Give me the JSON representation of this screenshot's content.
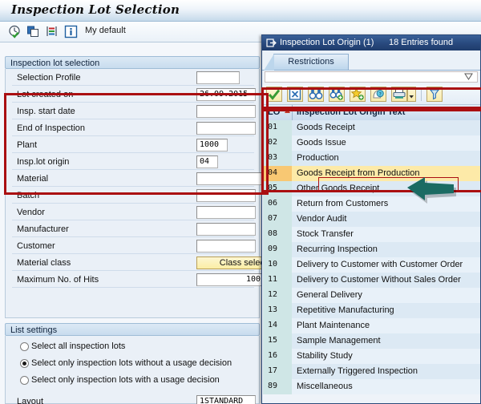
{
  "window": {
    "title": "Inspection Lot Selection",
    "toolbar": {
      "icons": [
        "execute-clock-icon",
        "copy-icon",
        "variant-icon",
        "info-icon"
      ],
      "my_default_label": "My default"
    }
  },
  "selection_section": {
    "header": "Inspection lot selection",
    "fields": [
      {
        "label": "Selection Profile",
        "value": "",
        "type": "input",
        "align": "left"
      },
      {
        "label": "Lot created on",
        "value": "26.09.2015",
        "type": "input",
        "align": "left"
      },
      {
        "label": "Insp. start date",
        "value": "",
        "type": "input",
        "align": "left"
      },
      {
        "label": "End of Inspection",
        "value": "",
        "type": "input",
        "align": "left"
      },
      {
        "label": "Plant",
        "value": "1000",
        "type": "input",
        "align": "left"
      },
      {
        "label": "Insp.lot origin",
        "value": "04",
        "type": "input",
        "align": "left"
      },
      {
        "label": "Material",
        "value": "",
        "type": "input",
        "align": "left"
      },
      {
        "label": "Batch",
        "value": "",
        "type": "input",
        "align": "left"
      },
      {
        "label": "Vendor",
        "value": "",
        "type": "input",
        "align": "left"
      },
      {
        "label": "Manufacturer",
        "value": "",
        "type": "input",
        "align": "left"
      },
      {
        "label": "Customer",
        "value": "",
        "type": "input",
        "align": "left"
      },
      {
        "label": "Material class",
        "value": "Class selec",
        "type": "button",
        "align": "right"
      },
      {
        "label": "Maximum No. of Hits",
        "value": "100",
        "type": "input",
        "align": "right"
      }
    ]
  },
  "list_settings": {
    "header": "List settings",
    "options": [
      {
        "label": "Select all inspection lots",
        "selected": false
      },
      {
        "label": "Select only inspection lots without a usage decision",
        "selected": true
      },
      {
        "label": "Select only inspection lots with a usage decision",
        "selected": false
      }
    ],
    "layout": {
      "label": "Layout",
      "value": "1STANDARD"
    }
  },
  "popup": {
    "title": "Inspection Lot Origin (1)",
    "entries_found": "18 Entries found",
    "tab": "Restrictions",
    "filter_value": "",
    "toolbar_icons": [
      "check-green-icon",
      "cancel-x-icon",
      "find-binoculars-icon",
      "find-next-binoculars-icon",
      "add-favorite-star-icon",
      "personal-value-list-icon",
      "print-icon",
      "print-dropdown-icon",
      "filter-funnel-icon"
    ],
    "table": {
      "columns": [
        "LO",
        "Inspection Lot Origin Text"
      ],
      "sorted_column": "LO",
      "rows": [
        {
          "key": "01",
          "text": "Goods Receipt",
          "selected": false
        },
        {
          "key": "02",
          "text": "Goods Issue",
          "selected": false
        },
        {
          "key": "03",
          "text": "Production",
          "selected": false
        },
        {
          "key": "04",
          "text": "Goods Receipt from Production",
          "selected": true
        },
        {
          "key": "05",
          "text": "Other Goods Receipt",
          "selected": false
        },
        {
          "key": "06",
          "text": "Return from Customers",
          "selected": false
        },
        {
          "key": "07",
          "text": "Vendor Audit",
          "selected": false
        },
        {
          "key": "08",
          "text": "Stock Transfer",
          "selected": false
        },
        {
          "key": "09",
          "text": "Recurring Inspection",
          "selected": false
        },
        {
          "key": "10",
          "text": "Delivery to Customer with Customer Order",
          "selected": false
        },
        {
          "key": "11",
          "text": "Delivery to Customer Without Sales Order",
          "selected": false
        },
        {
          "key": "12",
          "text": "General Delivery",
          "selected": false
        },
        {
          "key": "13",
          "text": "Repetitive Manufacturing",
          "selected": false
        },
        {
          "key": "14",
          "text": "Plant Maintenance",
          "selected": false
        },
        {
          "key": "15",
          "text": "Sample Management",
          "selected": false
        },
        {
          "key": "16",
          "text": "Stability Study",
          "selected": false
        },
        {
          "key": "17",
          "text": "Externally Triggered Inspection",
          "selected": false
        },
        {
          "key": "89",
          "text": "Miscellaneous",
          "selected": false
        }
      ]
    }
  },
  "annotations": {
    "highlight_color": "#aa0f11",
    "arrow_color": "#1b6b63"
  }
}
